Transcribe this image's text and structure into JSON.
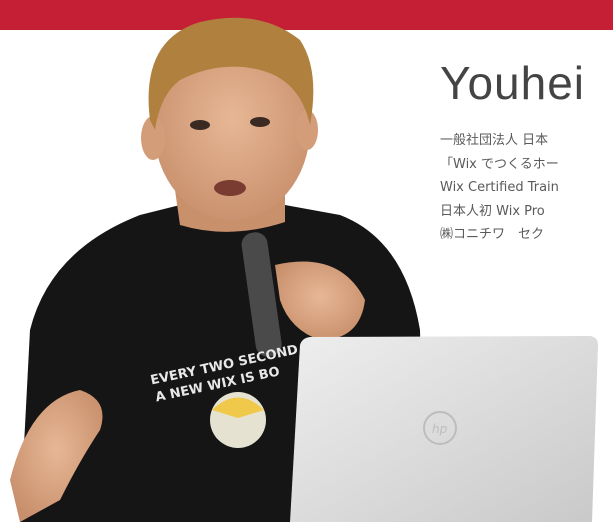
{
  "profile": {
    "name": "Youhei",
    "bio": [
      "一般社団法人 日本",
      "「Wix でつくるホー",
      "Wix Certified Train",
      "日本人初 Wix Pro",
      "㈱コニチワ　セク"
    ]
  },
  "shirt": {
    "line1": "EVERY TWO SECOND",
    "line2": "A NEW WIX IS BO"
  },
  "laptop": {
    "brand": "hp"
  },
  "colors": {
    "brand_bar": "#c51f35",
    "text": "#5a5a5a"
  }
}
